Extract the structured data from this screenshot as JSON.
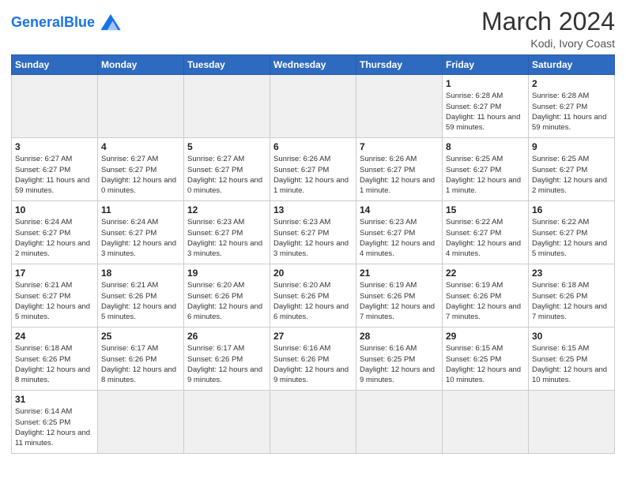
{
  "header": {
    "logo_text_normal": "General",
    "logo_text_colored": "Blue",
    "month_year": "March 2024",
    "location": "Kodi, Ivory Coast"
  },
  "weekdays": [
    "Sunday",
    "Monday",
    "Tuesday",
    "Wednesday",
    "Thursday",
    "Friday",
    "Saturday"
  ],
  "weeks": [
    [
      {
        "day": "",
        "info": "",
        "empty": true
      },
      {
        "day": "",
        "info": "",
        "empty": true
      },
      {
        "day": "",
        "info": "",
        "empty": true
      },
      {
        "day": "",
        "info": "",
        "empty": true
      },
      {
        "day": "",
        "info": "",
        "empty": true
      },
      {
        "day": "1",
        "info": "Sunrise: 6:28 AM\nSunset: 6:27 PM\nDaylight: 11 hours\nand 59 minutes."
      },
      {
        "day": "2",
        "info": "Sunrise: 6:28 AM\nSunset: 6:27 PM\nDaylight: 11 hours\nand 59 minutes."
      }
    ],
    [
      {
        "day": "3",
        "info": "Sunrise: 6:27 AM\nSunset: 6:27 PM\nDaylight: 11 hours\nand 59 minutes."
      },
      {
        "day": "4",
        "info": "Sunrise: 6:27 AM\nSunset: 6:27 PM\nDaylight: 12 hours\nand 0 minutes."
      },
      {
        "day": "5",
        "info": "Sunrise: 6:27 AM\nSunset: 6:27 PM\nDaylight: 12 hours\nand 0 minutes."
      },
      {
        "day": "6",
        "info": "Sunrise: 6:26 AM\nSunset: 6:27 PM\nDaylight: 12 hours\nand 1 minute."
      },
      {
        "day": "7",
        "info": "Sunrise: 6:26 AM\nSunset: 6:27 PM\nDaylight: 12 hours\nand 1 minute."
      },
      {
        "day": "8",
        "info": "Sunrise: 6:25 AM\nSunset: 6:27 PM\nDaylight: 12 hours\nand 1 minute."
      },
      {
        "day": "9",
        "info": "Sunrise: 6:25 AM\nSunset: 6:27 PM\nDaylight: 12 hours\nand 2 minutes."
      }
    ],
    [
      {
        "day": "10",
        "info": "Sunrise: 6:24 AM\nSunset: 6:27 PM\nDaylight: 12 hours\nand 2 minutes."
      },
      {
        "day": "11",
        "info": "Sunrise: 6:24 AM\nSunset: 6:27 PM\nDaylight: 12 hours\nand 3 minutes."
      },
      {
        "day": "12",
        "info": "Sunrise: 6:23 AM\nSunset: 6:27 PM\nDaylight: 12 hours\nand 3 minutes."
      },
      {
        "day": "13",
        "info": "Sunrise: 6:23 AM\nSunset: 6:27 PM\nDaylight: 12 hours\nand 3 minutes."
      },
      {
        "day": "14",
        "info": "Sunrise: 6:23 AM\nSunset: 6:27 PM\nDaylight: 12 hours\nand 4 minutes."
      },
      {
        "day": "15",
        "info": "Sunrise: 6:22 AM\nSunset: 6:27 PM\nDaylight: 12 hours\nand 4 minutes."
      },
      {
        "day": "16",
        "info": "Sunrise: 6:22 AM\nSunset: 6:27 PM\nDaylight: 12 hours\nand 5 minutes."
      }
    ],
    [
      {
        "day": "17",
        "info": "Sunrise: 6:21 AM\nSunset: 6:27 PM\nDaylight: 12 hours\nand 5 minutes."
      },
      {
        "day": "18",
        "info": "Sunrise: 6:21 AM\nSunset: 6:26 PM\nDaylight: 12 hours\nand 5 minutes."
      },
      {
        "day": "19",
        "info": "Sunrise: 6:20 AM\nSunset: 6:26 PM\nDaylight: 12 hours\nand 6 minutes."
      },
      {
        "day": "20",
        "info": "Sunrise: 6:20 AM\nSunset: 6:26 PM\nDaylight: 12 hours\nand 6 minutes."
      },
      {
        "day": "21",
        "info": "Sunrise: 6:19 AM\nSunset: 6:26 PM\nDaylight: 12 hours\nand 7 minutes."
      },
      {
        "day": "22",
        "info": "Sunrise: 6:19 AM\nSunset: 6:26 PM\nDaylight: 12 hours\nand 7 minutes."
      },
      {
        "day": "23",
        "info": "Sunrise: 6:18 AM\nSunset: 6:26 PM\nDaylight: 12 hours\nand 7 minutes."
      }
    ],
    [
      {
        "day": "24",
        "info": "Sunrise: 6:18 AM\nSunset: 6:26 PM\nDaylight: 12 hours\nand 8 minutes."
      },
      {
        "day": "25",
        "info": "Sunrise: 6:17 AM\nSunset: 6:26 PM\nDaylight: 12 hours\nand 8 minutes."
      },
      {
        "day": "26",
        "info": "Sunrise: 6:17 AM\nSunset: 6:26 PM\nDaylight: 12 hours\nand 9 minutes."
      },
      {
        "day": "27",
        "info": "Sunrise: 6:16 AM\nSunset: 6:26 PM\nDaylight: 12 hours\nand 9 minutes."
      },
      {
        "day": "28",
        "info": "Sunrise: 6:16 AM\nSunset: 6:25 PM\nDaylight: 12 hours\nand 9 minutes."
      },
      {
        "day": "29",
        "info": "Sunrise: 6:15 AM\nSunset: 6:25 PM\nDaylight: 12 hours\nand 10 minutes."
      },
      {
        "day": "30",
        "info": "Sunrise: 6:15 AM\nSunset: 6:25 PM\nDaylight: 12 hours\nand 10 minutes."
      }
    ],
    [
      {
        "day": "31",
        "info": "Sunrise: 6:14 AM\nSunset: 6:25 PM\nDaylight: 12 hours\nand 11 minutes."
      },
      {
        "day": "",
        "info": "",
        "empty": true
      },
      {
        "day": "",
        "info": "",
        "empty": true
      },
      {
        "day": "",
        "info": "",
        "empty": true
      },
      {
        "day": "",
        "info": "",
        "empty": true
      },
      {
        "day": "",
        "info": "",
        "empty": true
      },
      {
        "day": "",
        "info": "",
        "empty": true
      }
    ]
  ]
}
